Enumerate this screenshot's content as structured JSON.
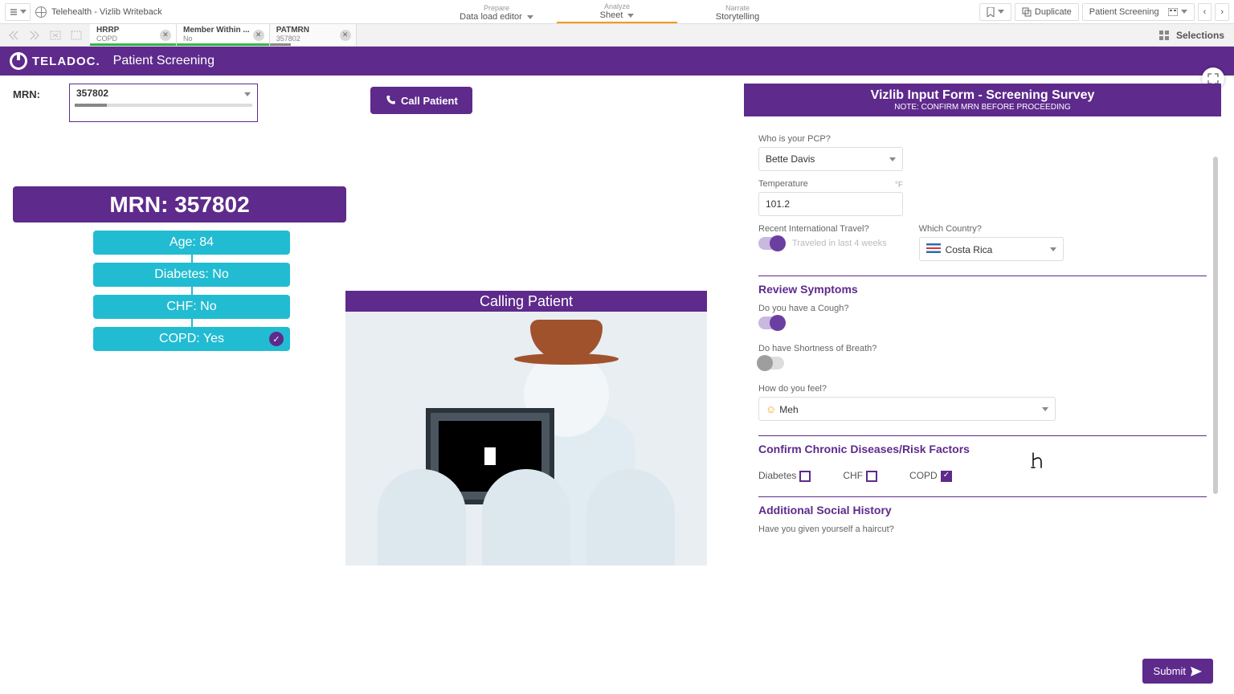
{
  "topbar": {
    "title": "Telehealth - Vizlib Writeback",
    "tabs": {
      "prepare": {
        "lbl": "Prepare",
        "val": "Data load editor"
      },
      "analyze": {
        "lbl": "Analyze",
        "val": "Sheet"
      },
      "narrate": {
        "lbl": "Narrate",
        "val": "Storytelling"
      }
    },
    "duplicate": "Duplicate",
    "sheet": "Patient Screening"
  },
  "selbar": {
    "chips": [
      {
        "t": "HRRP",
        "v": "COPD",
        "bar": "100%"
      },
      {
        "t": "Member Within ...",
        "v": "No",
        "bar": "100%"
      },
      {
        "t": "PATMRN",
        "v": "357802",
        "bar": "25%"
      }
    ],
    "selections": "Selections"
  },
  "banner": {
    "brand": "TELADOC.",
    "title": "Patient Screening"
  },
  "mrn": {
    "label": "MRN:",
    "value": "357802"
  },
  "call_button": "Call Patient",
  "pinfo": {
    "main": "MRN: 357802",
    "rows": [
      "Age: 84",
      "Diabetes: No",
      "CHF: No",
      "COPD: Yes"
    ]
  },
  "call_panel": {
    "title": "Calling Patient"
  },
  "form": {
    "title": "Vizlib Input Form - Screening Survey",
    "subtitle": "NOTE: CONFIRM MRN BEFORE PROCEEDING",
    "pcp": {
      "label": "Who is your PCP?",
      "value": "Bette Davis"
    },
    "temp": {
      "label": "Temperature",
      "unit": "°F",
      "value": "101.2"
    },
    "travel": {
      "label": "Recent International Travel?",
      "hint": "Traveled in last 4 weeks"
    },
    "country": {
      "label": "Which Country?",
      "value": "Costa Rica"
    },
    "symptoms": {
      "title": "Review Symptoms",
      "cough": "Do you have a Cough?",
      "breath": "Do have Shortness of Breath?",
      "feel": {
        "label": "How do you feel?",
        "value": "Meh"
      }
    },
    "chronic": {
      "title": "Confirm Chronic Diseases/Risk Factors",
      "diabetes": "Diabetes",
      "chf": "CHF",
      "copd": "COPD"
    },
    "social": {
      "title": "Additional Social History",
      "q1": "Have you given yourself a haircut?"
    },
    "submit": "Submit"
  }
}
